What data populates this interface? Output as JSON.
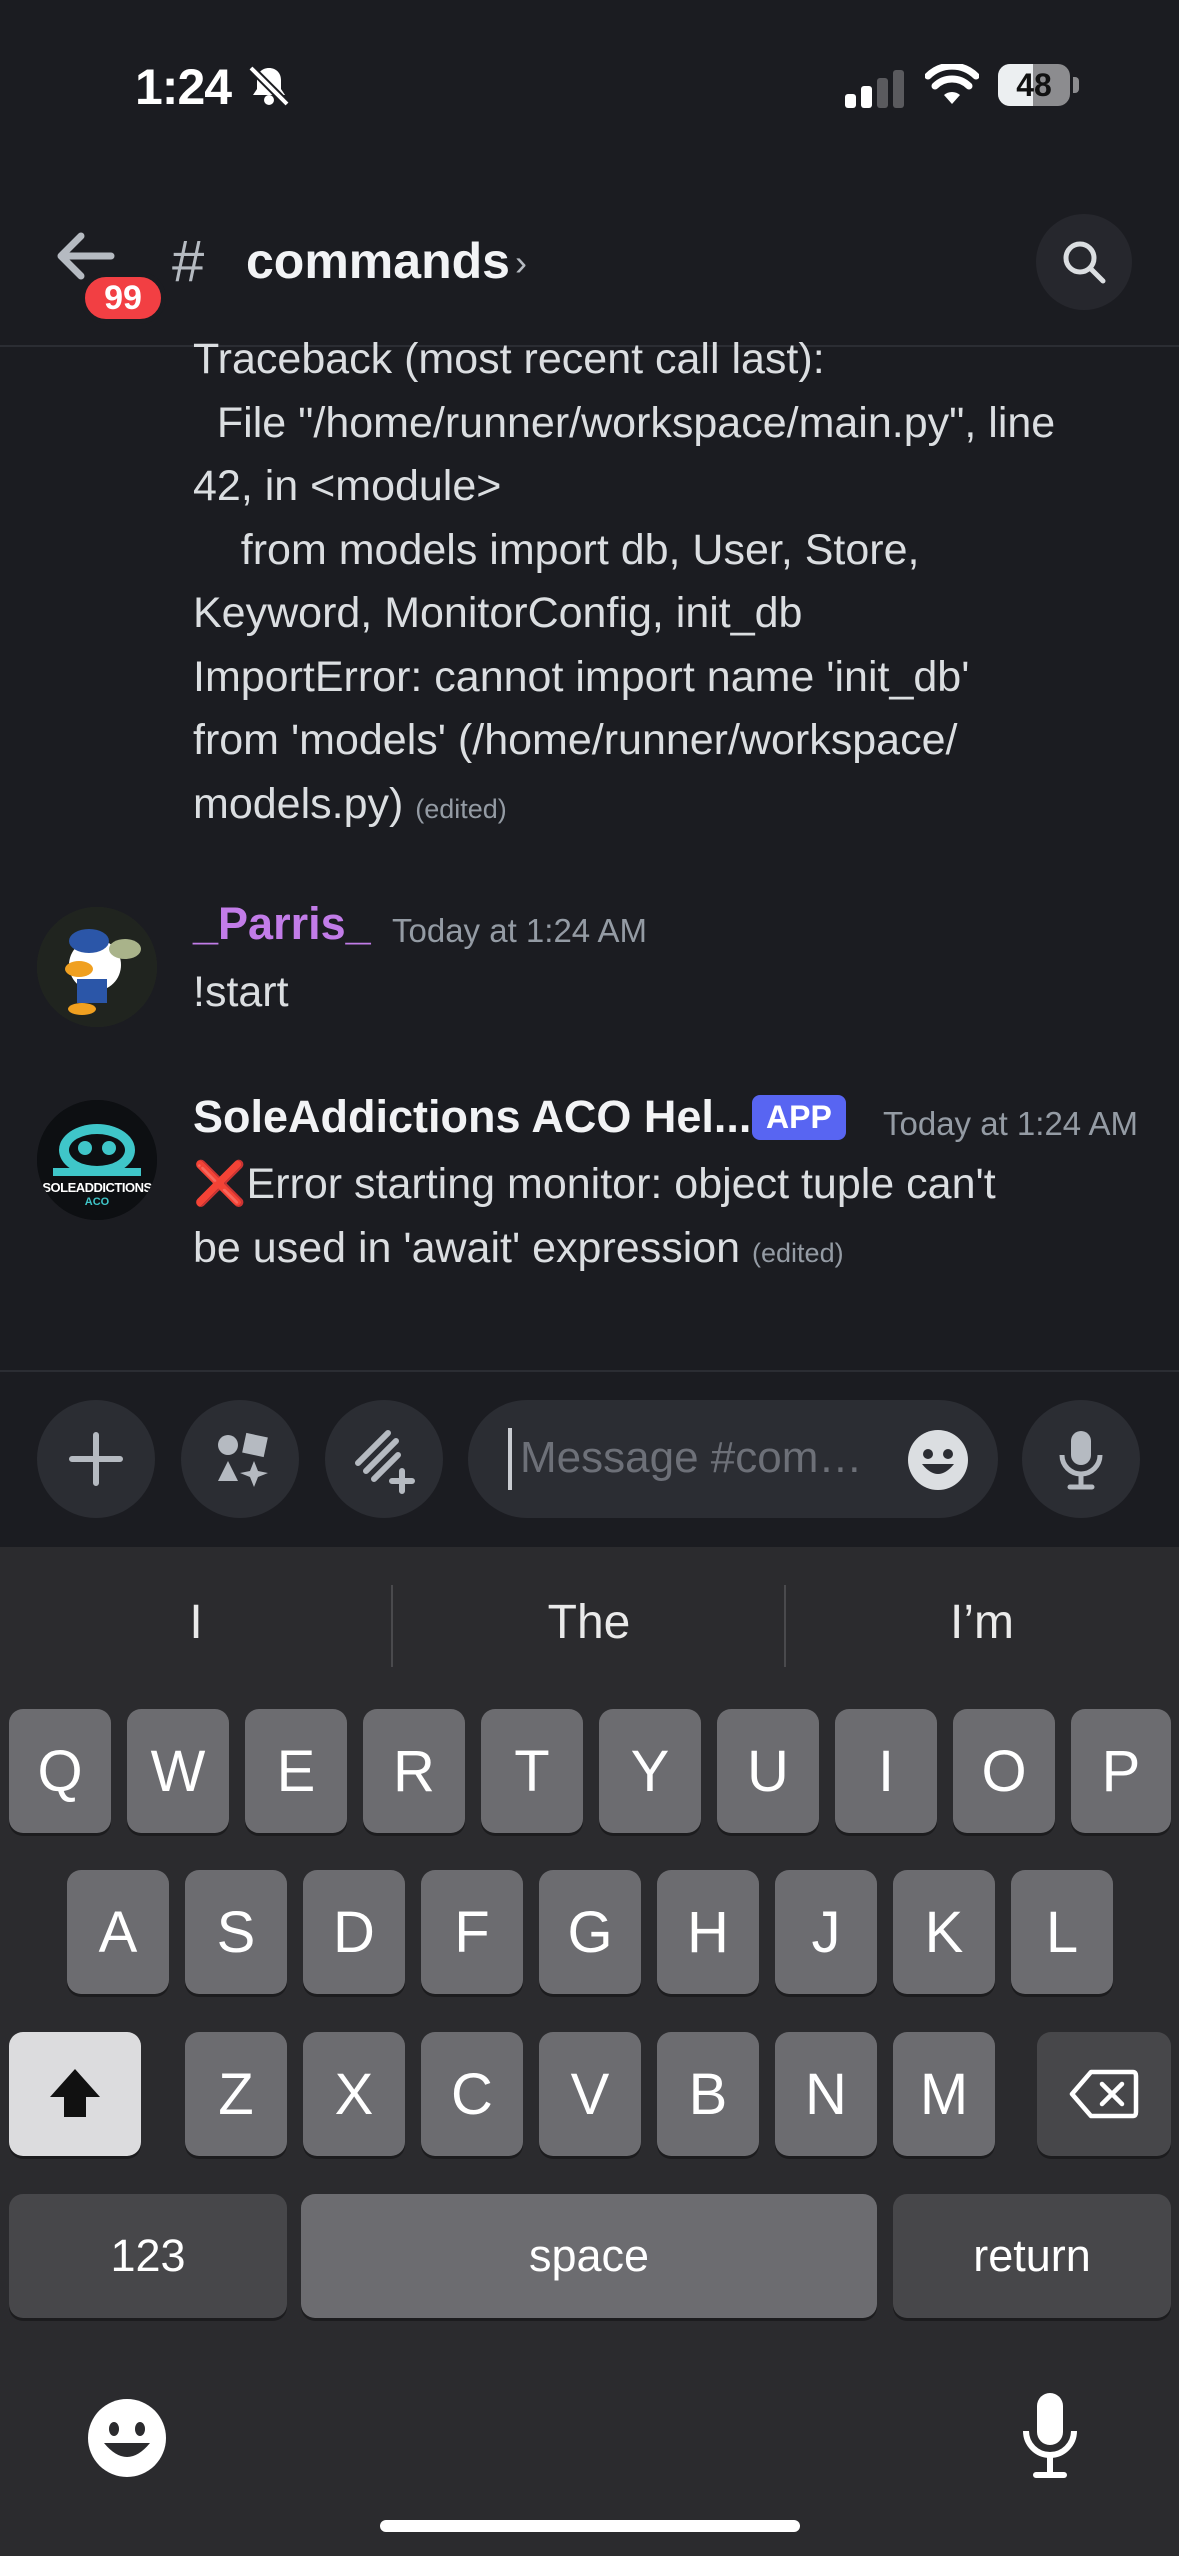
{
  "status_bar": {
    "time": "1:24",
    "battery": "48",
    "battery_level": 0.48
  },
  "header": {
    "back_badge": "99",
    "hash": "#",
    "channel_name": "commands",
    "chevron": "›"
  },
  "messages": {
    "first": {
      "lines": [
        "Traceback (most recent call last):",
        "  File \"/home/runner/workspace/main.py\", line",
        "42, in <module>",
        "    from models import db, User, Store,",
        "Keyword, MonitorConfig, init_db",
        "ImportError: cannot import name 'init_db'",
        "from 'models' (/home/runner/workspace/",
        "models.py)"
      ],
      "edited": "(edited)"
    },
    "second": {
      "author": "_Parris_",
      "author_color": "#c27ce8",
      "timestamp": "Today at 1:24 AM",
      "text": "!start"
    },
    "third": {
      "author": "SoleAddictions ACO Hel...",
      "app_tag": "APP",
      "timestamp": "Today at 1:24 AM",
      "emoji": "❌",
      "line1": "Error starting monitor: object tuple can't",
      "line2": "be used in 'await' expression",
      "edited": "(edited)",
      "avatar_text": "SOLEADDICTIONS",
      "avatar_sub": "ACO"
    }
  },
  "composer": {
    "placeholder": "Message #commands"
  },
  "keyboard": {
    "suggestions": [
      "I",
      "The",
      "I’m"
    ],
    "row1": [
      "Q",
      "W",
      "E",
      "R",
      "T",
      "Y",
      "U",
      "I",
      "O",
      "P"
    ],
    "row2": [
      "A",
      "S",
      "D",
      "F",
      "G",
      "H",
      "J",
      "K",
      "L"
    ],
    "row3": [
      "Z",
      "X",
      "C",
      "V",
      "B",
      "N",
      "M"
    ],
    "numbers_key": "123",
    "space_key": "space",
    "return_key": "return"
  },
  "colors": {
    "background": "#1b1c21",
    "badge": "#f23f43",
    "app_tag": "#5865f2",
    "keyboard": "#2b2b2e"
  }
}
